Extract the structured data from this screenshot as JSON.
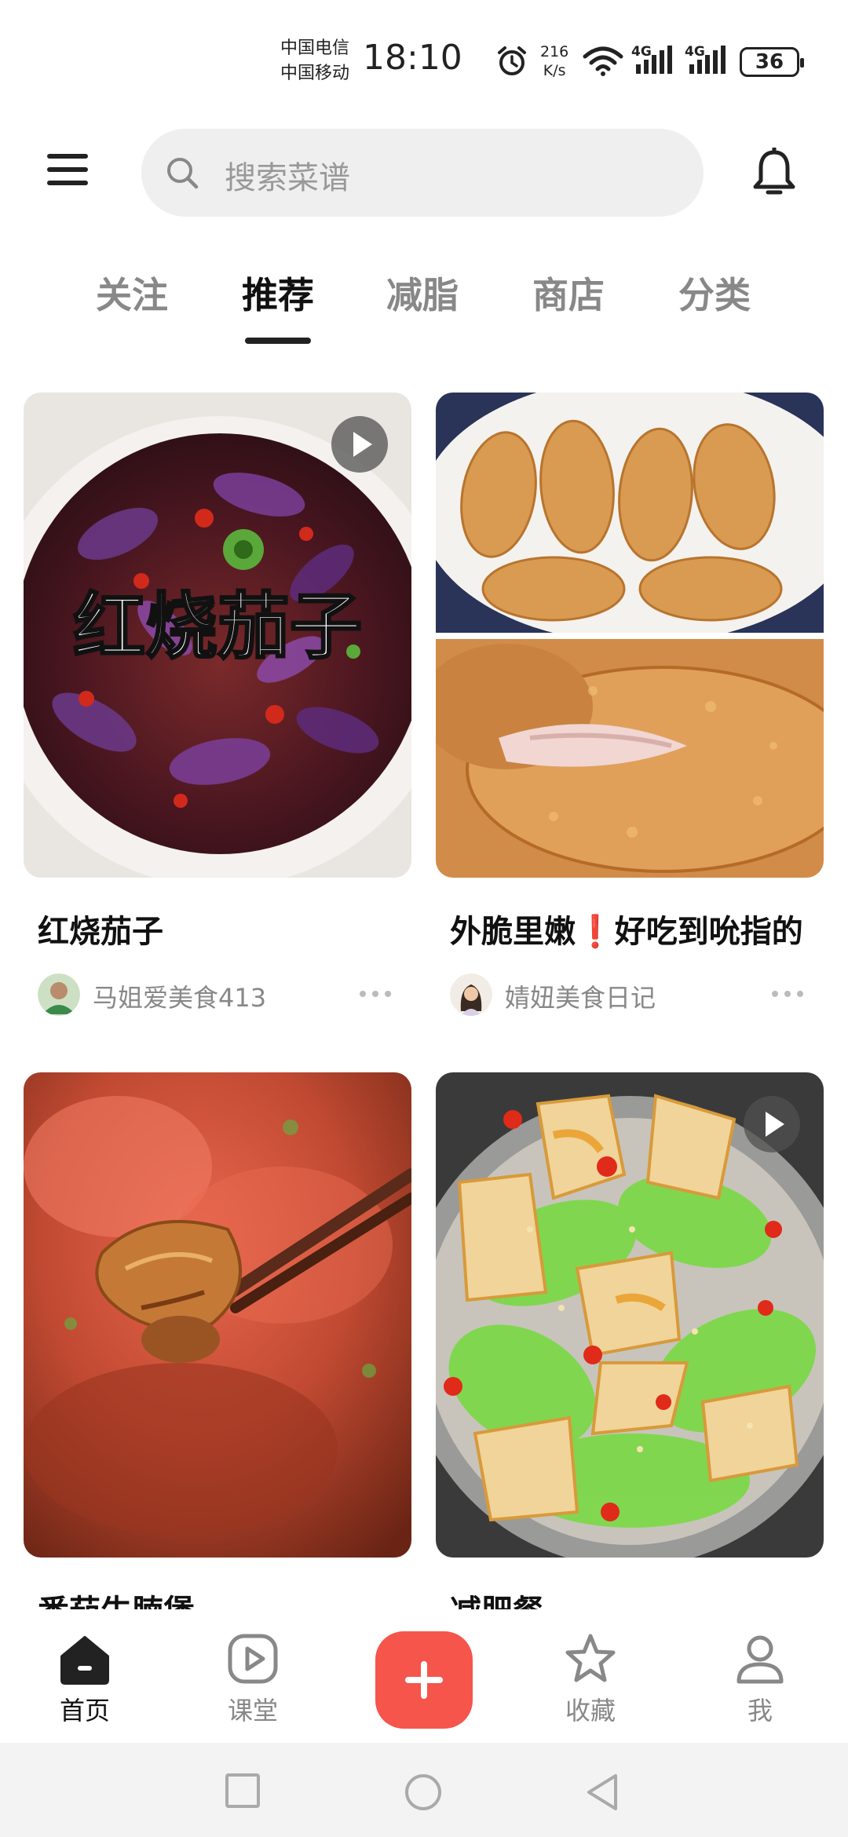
{
  "status_bar": {
    "carrier_1": "中国电信",
    "carrier_2": "中国移动",
    "time": "18:10",
    "speed_value": "216",
    "speed_unit": "K/s",
    "network_1": "4G",
    "network_2": "4G",
    "battery": "36"
  },
  "header": {
    "search_placeholder": "搜索菜谱"
  },
  "tabs": [
    {
      "label": "关注",
      "active": false
    },
    {
      "label": "推荐",
      "active": true
    },
    {
      "label": "减脂",
      "active": false
    },
    {
      "label": "商店",
      "active": false
    },
    {
      "label": "分类",
      "active": false
    }
  ],
  "feed": [
    {
      "image_text": "红烧茄子",
      "title": "红烧茄子",
      "author": "马姐爱美食413",
      "is_video": true
    },
    {
      "title": "外脆里嫩❗好吃到吮指的",
      "author": "婧妞美食日记",
      "is_video": false
    },
    {
      "title": "番茄牛腩煲",
      "is_video": false
    },
    {
      "title": "减肥餐",
      "is_video": true
    }
  ],
  "bottom_nav": [
    {
      "label": "首页",
      "icon": "home-icon",
      "active": true
    },
    {
      "label": "课堂",
      "icon": "play-icon",
      "active": false
    },
    {
      "label": "",
      "icon": "plus-icon",
      "active": false
    },
    {
      "label": "收藏",
      "icon": "star-icon",
      "active": false
    },
    {
      "label": "我",
      "icon": "user-icon",
      "active": false
    }
  ],
  "colors": {
    "accent": "#f5554a",
    "text_primary": "#111111",
    "text_secondary": "#888888",
    "search_bg": "#efefef"
  }
}
